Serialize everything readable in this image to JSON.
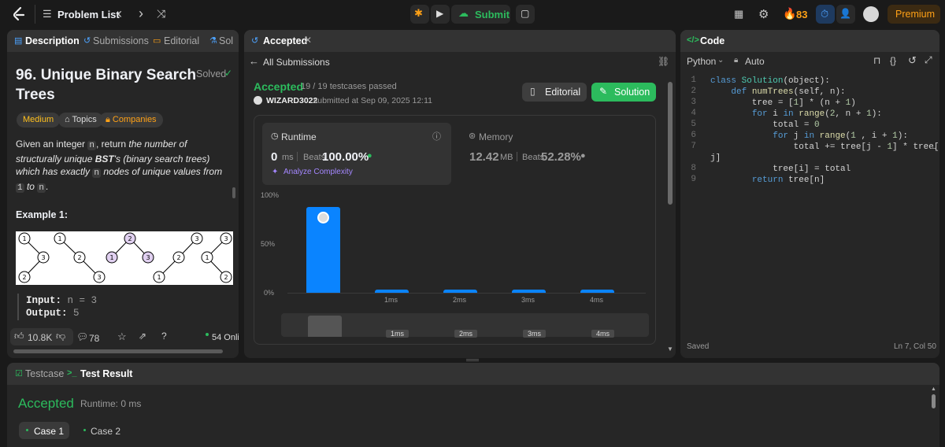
{
  "topbar": {
    "problem_list": "Problem List",
    "submit": "Submit",
    "streak": "83",
    "premium": "Premium"
  },
  "left": {
    "tabs": [
      "Description",
      "Submissions",
      "Editorial",
      "Sol"
    ],
    "title_line1": "96. Unique Binary Search",
    "title_line2": "Trees",
    "solved": "Solved",
    "difficulty": "Medium",
    "topics": "Topics",
    "companies": "Companies",
    "desc_given": "Given an integer",
    "desc_n": "n",
    "desc_return": ", return",
    "desc_italic1": "the number of structurally",
    "desc_unique": "unique",
    "desc_bst": "BST",
    "desc_rest": "'s (binary search trees) which has exactly",
    "desc_nodes": "nodes of unique values from",
    "desc_one": "1",
    "desc_to": "to",
    "desc_period": ".",
    "example_title": "Example 1:",
    "input_label": "Input:",
    "input_value": "n = 3",
    "output_label": "Output:",
    "output_value": "5",
    "likes": "10.8K",
    "comments": "78",
    "online": "54 Onli"
  },
  "middle": {
    "tab": "Accepted",
    "all_submissions": "All Submissions",
    "status": "Accepted",
    "testcases": "19 / 19 testcases passed",
    "user": "WIZARD3022",
    "submitted": "submitted at Sep 09, 2025 12:11",
    "editorial_btn": "Editorial",
    "solution_btn": "Solution",
    "runtime_label": "Runtime",
    "runtime_value": "0",
    "runtime_unit": "ms",
    "beats": "Beats",
    "runtime_beats": "100.00%",
    "analyze": "Analyze Complexity",
    "memory_label": "Memory",
    "memory_value": "12.42",
    "memory_unit": "MB",
    "memory_beats": "52.28%"
  },
  "chart_data": {
    "type": "bar",
    "categories": [
      "0ms",
      "1ms",
      "2ms",
      "3ms",
      "4ms"
    ],
    "values": [
      88,
      3,
      3,
      3,
      3
    ],
    "tick_labels": [
      "",
      "1ms",
      "2ms",
      "3ms",
      "4ms"
    ],
    "y_ticks": [
      "100%",
      "50%",
      "0%"
    ],
    "ylim": [
      0,
      100
    ],
    "color": "#0a84ff"
  },
  "right": {
    "tab": "Code",
    "language": "Python",
    "auto": "Auto",
    "saved": "Saved",
    "position": "Ln 7, Col 50",
    "line_numbers": [
      "1",
      "2",
      "3",
      "4",
      "5",
      "6",
      "7",
      "",
      "8",
      "9"
    ]
  },
  "bottom": {
    "tab_testcase": "Testcase",
    "tab_result": "Test Result",
    "status": "Accepted",
    "runtime": "Runtime: 0 ms",
    "case1": "Case 1",
    "case2": "Case 2"
  },
  "colors": {
    "accent_green": "#2cbb5d",
    "accent_blue": "#0a84ff",
    "medium": "#ffc01e",
    "premium": "#ffa116"
  }
}
